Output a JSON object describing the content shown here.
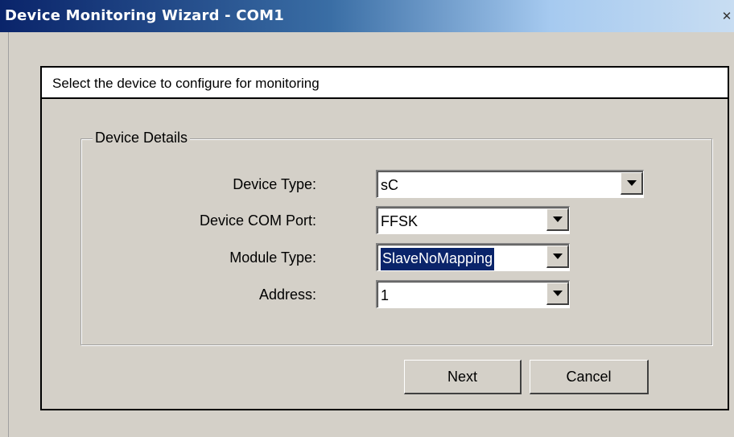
{
  "window": {
    "title": "Device Monitoring Wizard - COM1",
    "close_glyph": "✕"
  },
  "header": {
    "text": "Select the device to configure for monitoring"
  },
  "group": {
    "legend": "Device Details",
    "fields": [
      {
        "label": "Device Type:",
        "value": "sC"
      },
      {
        "label": "Device COM Port:",
        "value": "FFSK"
      },
      {
        "label": "Module Type:",
        "value": "SlaveNoMapping"
      },
      {
        "label": "Address:",
        "value": "1"
      }
    ]
  },
  "buttons": {
    "next": "Next",
    "cancel": "Cancel"
  },
  "colors": {
    "selection_bg": "#0a246a",
    "dialog_bg": "#d4d0c8"
  }
}
